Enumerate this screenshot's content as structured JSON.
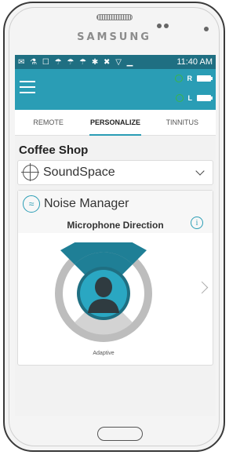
{
  "device": {
    "brand": "SAMSUNG"
  },
  "status_bar": {
    "icons": "✉ ⚗ ☐ ☂ ☂ ☂ ✱ ✖ ▽ ▁",
    "time": "11:40 AM"
  },
  "app_bar": {
    "left_ear_label": "L",
    "right_ear_label": "R"
  },
  "tabs": [
    {
      "label": "REMOTE"
    },
    {
      "label": "PERSONALIZE",
      "active": true
    },
    {
      "label": "TINNITUS"
    }
  ],
  "program": {
    "title": "Coffee Shop"
  },
  "soundspace": {
    "label": "SoundSpace"
  },
  "noise_manager": {
    "label": "Noise Manager",
    "mic_direction_label": "Microphone Direction",
    "info_glyph": "i",
    "mode_label": "Adaptive"
  },
  "colors": {
    "accent": "#2a9db5",
    "status_bar": "#1f6f82",
    "ear_dot": "#39b54a",
    "dial_ring": "#bdbdbd",
    "dial_top": "#1f7f96",
    "dial_bottom": "#cfcfcf"
  }
}
